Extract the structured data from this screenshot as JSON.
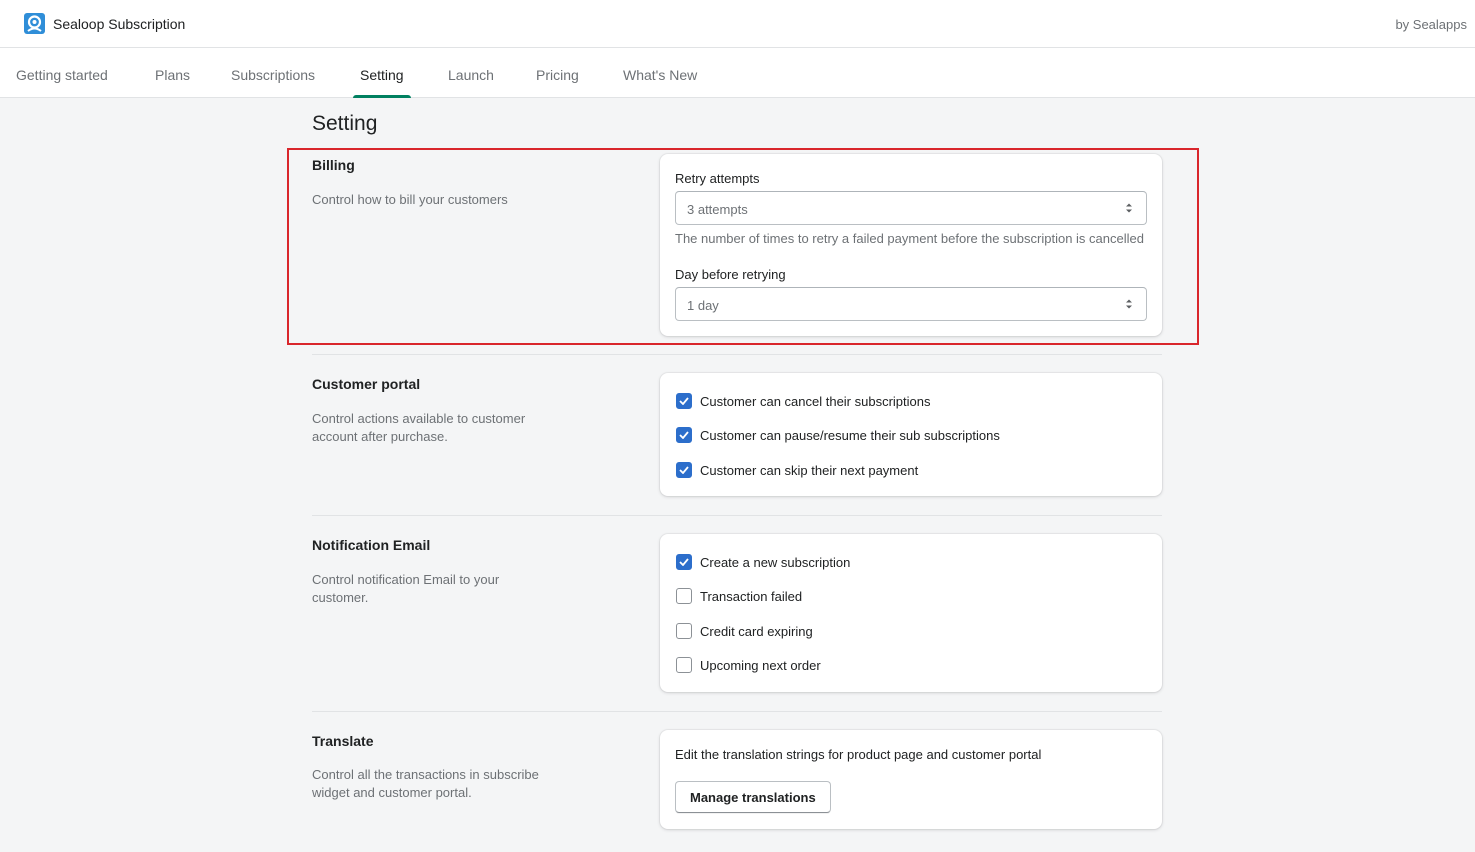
{
  "app": {
    "title": "Sealoop Subscription",
    "by": "by Sealapps"
  },
  "tabs": [
    {
      "label": "Getting started"
    },
    {
      "label": "Plans"
    },
    {
      "label": "Subscriptions"
    },
    {
      "label": "Setting",
      "active": true
    },
    {
      "label": "Launch"
    },
    {
      "label": "Pricing"
    },
    {
      "label": "What's New"
    }
  ],
  "page": {
    "title": "Setting"
  },
  "billing": {
    "title": "Billing",
    "desc": "Control how to bill your customers",
    "retry_label": "Retry attempts",
    "retry_value": "3 attempts",
    "retry_help": "The number of times to retry a failed payment before the subscription is cancelled",
    "days_label": "Day before retrying",
    "days_value": "1 day"
  },
  "portal": {
    "title": "Customer portal",
    "desc": "Control actions available to customer account after purchase.",
    "options": [
      {
        "label": "Customer can cancel their subscriptions",
        "checked": true
      },
      {
        "label": "Customer can pause/resume their sub subscriptions",
        "checked": true
      },
      {
        "label": "Customer can skip their next payment",
        "checked": true
      }
    ]
  },
  "notification": {
    "title": "Notification Email",
    "desc": "Control notification Email to your customer.",
    "options": [
      {
        "label": "Create a new subscription",
        "checked": true
      },
      {
        "label": "Transaction failed",
        "checked": false
      },
      {
        "label": "Credit card expiring",
        "checked": false
      },
      {
        "label": "Upcoming next order",
        "checked": false
      }
    ]
  },
  "translate": {
    "title": "Translate",
    "desc": "Control all the transactions in subscribe widget and customer portal.",
    "text": "Edit the translation strings for product page and customer portal",
    "button": "Manage translations"
  },
  "colors": {
    "accent": "#008060",
    "checkbox": "#2c6ecb",
    "highlight": "#d9262c"
  }
}
